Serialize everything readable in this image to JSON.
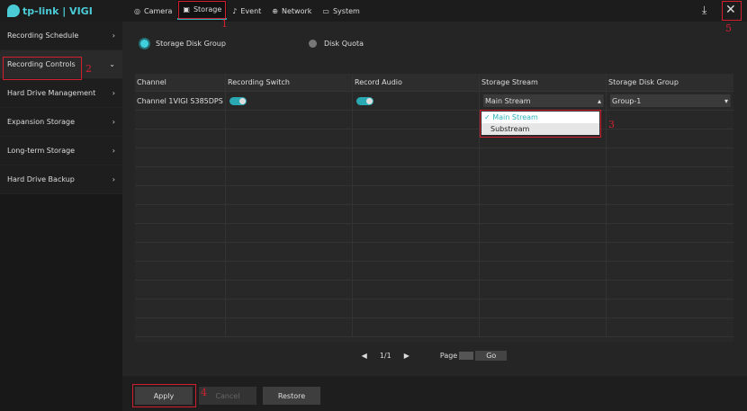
{
  "brand": "tp-link | VIGI",
  "nav": [
    {
      "label": "Camera",
      "icon": "camera-icon"
    },
    {
      "label": "Storage",
      "icon": "floppy-icon"
    },
    {
      "label": "Event",
      "icon": "bell-icon"
    },
    {
      "label": "Network",
      "icon": "globe-icon"
    },
    {
      "label": "System",
      "icon": "monitor-icon"
    }
  ],
  "sidebar": [
    {
      "label": "Recording Schedule"
    },
    {
      "label": "Recording Controls"
    },
    {
      "label": "Hard Drive Management"
    },
    {
      "label": "Expansion Storage"
    },
    {
      "label": "Long-term Storage"
    },
    {
      "label": "Hard Drive Backup"
    }
  ],
  "radios": {
    "storage_disk_group": "Storage Disk Group",
    "disk_quota": "Disk Quota",
    "selected": "Storage Disk Group"
  },
  "table": {
    "headers": [
      "Channel",
      "Recording Switch",
      "Record Audio",
      "Storage Stream",
      "Storage Disk Group"
    ],
    "row": {
      "channel": "Channel 1VIGI S385DPS 1...",
      "recording_switch": true,
      "record_audio": true,
      "storage_stream": "Main Stream",
      "storage_disk_group": "Group-1"
    }
  },
  "stream_menu": {
    "options": [
      "Main Stream",
      "Substream"
    ],
    "selected": "Main Stream"
  },
  "pager": {
    "page": "1/1",
    "page_label": "Page",
    "go": "Go"
  },
  "buttons": {
    "apply": "Apply",
    "cancel": "Cancel",
    "restore": "Restore"
  },
  "annotations": [
    "1",
    "2",
    "3",
    "4",
    "5"
  ],
  "colors": {
    "accent": "#3fd0dc",
    "annotation": "#d02030"
  }
}
